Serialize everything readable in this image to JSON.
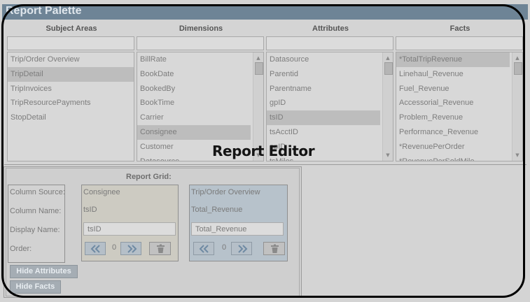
{
  "palette": {
    "title": "Report Palette"
  },
  "columns": [
    {
      "header": "Subject Areas",
      "items": [
        "Trip/Order Overview",
        "TripDetail",
        "TripInvoices",
        "TripResourcePayments",
        "StopDetail"
      ],
      "selected_index": 1,
      "scrollbar": false
    },
    {
      "header": "Dimensions",
      "items": [
        "BillRate",
        "BookDate",
        "BookedBy",
        "BookTime",
        "Carrier",
        "Consignee",
        "Customer",
        "Datasource"
      ],
      "selected_index": 5,
      "scrollbar": true
    },
    {
      "header": "Attributes",
      "items": [
        "Datasource",
        "Parentid",
        "Parentname",
        "gpID",
        "tsID",
        "tsAcctID",
        "gpID",
        "tsMiles"
      ],
      "selected_index": 4,
      "scrollbar": true
    },
    {
      "header": "Facts",
      "items": [
        "*TotalTripRevenue",
        "Linehaul_Revenue",
        "Fuel_Revenue",
        "Accessorial_Revenue",
        "Problem_Revenue",
        "Performance_Revenue",
        "*RevenuePerOrder",
        "*RevenuePerSoldMile"
      ],
      "selected_index": 0,
      "scrollbar": true
    }
  ],
  "editor": {
    "title": "Report Editor"
  },
  "grid": {
    "title": "Report Grid:",
    "row_labels": {
      "source": "Column Source:",
      "name": "Column Name:",
      "display": "Display Name:",
      "order": "Order:"
    },
    "columns": [
      {
        "source": "Consignee",
        "name": "tsID",
        "display": "tsID",
        "order": "0"
      },
      {
        "source": "Trip/Order Overview",
        "name": "Total_Revenue",
        "display": "Total_Revenue",
        "order": "0"
      }
    ]
  },
  "buttons": {
    "hide_attributes": "Hide Attributes",
    "hide_facts": "Hide Facts"
  },
  "icons": [
    "chevron-left-icon",
    "chevron-right-icon",
    "trash-icon",
    "scroll-up-icon",
    "scroll-down-icon"
  ],
  "colors": {
    "title_bar": "#6e8496",
    "selected_row": "#bdbdbd",
    "button_blue": "#b5bfc8"
  }
}
